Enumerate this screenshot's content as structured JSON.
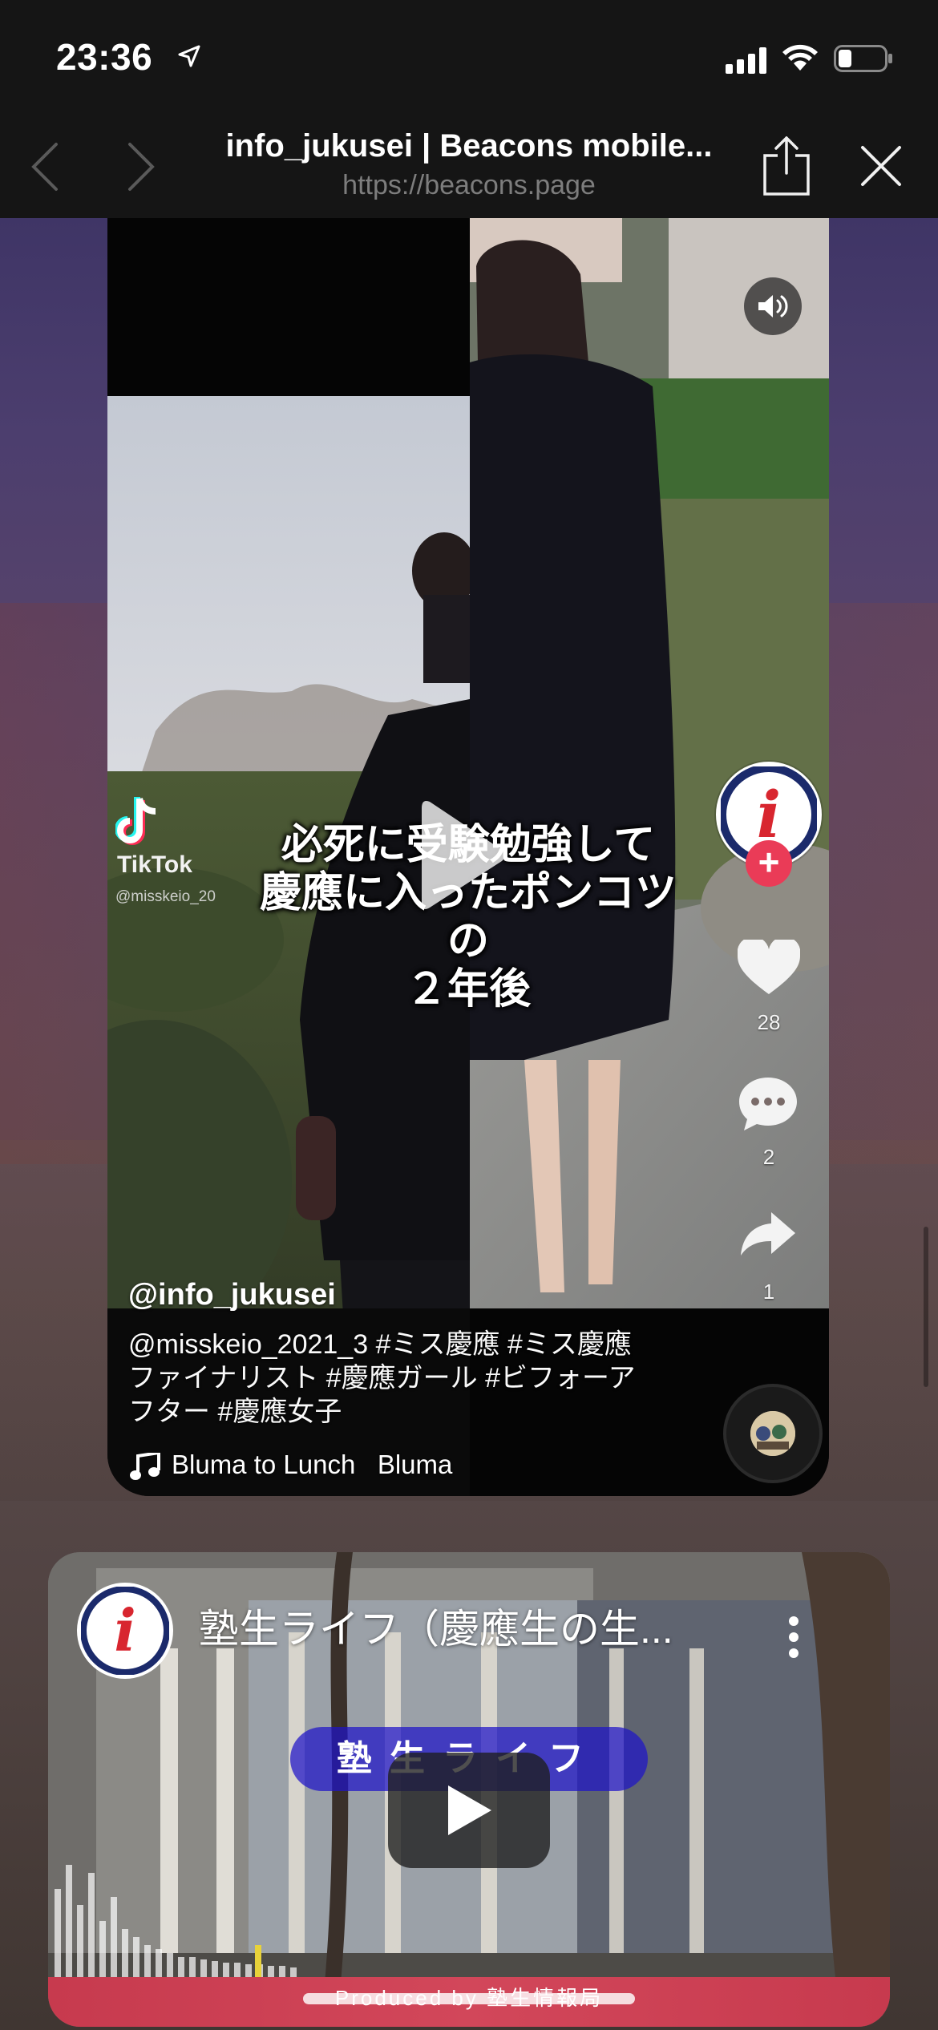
{
  "status_bar": {
    "time": "23:36"
  },
  "browser": {
    "title": "info_jukusei | Beacons mobile...",
    "url": "https://beacons.page"
  },
  "tiktok": {
    "platform_label": "TikTok",
    "watermark": "@misskeio_20",
    "overlay_caption": [
      "必死に受験勉強して",
      "慶應に入ったポンコツ",
      "の",
      "２年後"
    ],
    "likes": "28",
    "comments": "2",
    "shares": "1",
    "username": "@info_jukusei",
    "description": "@misskeio_2021_3 #ミス慶應 #ミス慶應ファイナリスト #慶應ガール #ビフォーアフター #慶應女子",
    "music": "Bluma to Lunch   Bluma",
    "avatar_letter": "i"
  },
  "youtube": {
    "title": "塾生ライフ（慶應生の生...",
    "banner": "塾生ライフ",
    "footer": "Produced by 塾生情報局",
    "avatar_letter": "i"
  },
  "colors": {
    "accent_red": "#ea3b57",
    "brand_navy": "#1b2a6b",
    "brand_red": "#d8262f"
  }
}
